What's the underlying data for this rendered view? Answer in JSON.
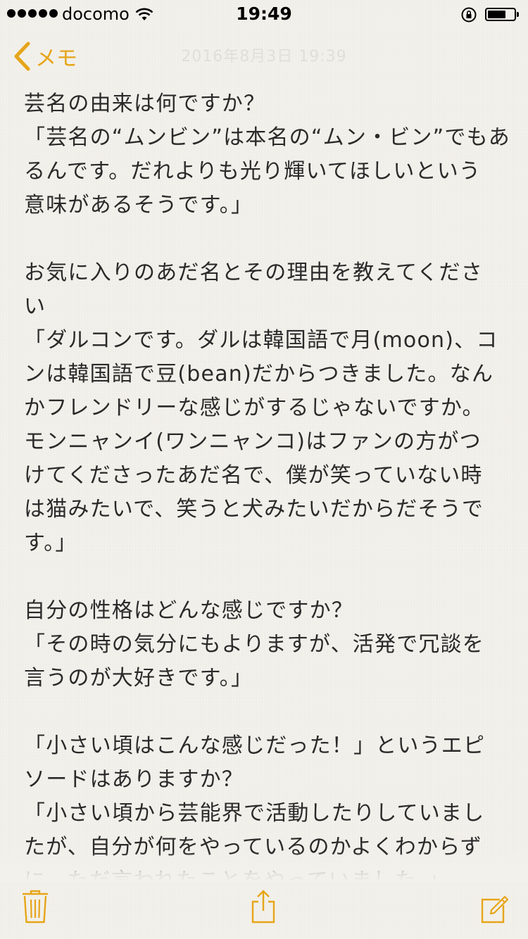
{
  "status_bar": {
    "carrier": "docomo",
    "time": "19:49",
    "battery_level": 0.7
  },
  "nav": {
    "back_label": "メモ",
    "date_text": "2016年8月3日 19:39"
  },
  "note": {
    "paragraphs": [
      {
        "lines": [
          "芸名の由来は何ですか？",
          "「芸名の“ムンビン”は本名の“ムン・ビン”でもあ",
          "るんです。だれよりも光り輝いてほしいという",
          "意味があるそうです。」"
        ]
      },
      {
        "lines": [
          "お気に入りのあだ名とその理由を教えてくださ",
          "い",
          "「ダルコンです。ダルは韓国語で月(moon)、コ",
          "ンは韓国語で豆(bean)だからつきました。なん",
          "かフレンドリーな感じがするじゃないですか。",
          "モンニャンイ(ワンニャンコ)はファンの方がつ",
          "けてくださったあだ名で、僕が笑っていない時",
          "は猫みたいで、笑うと犬みたいだからだそうで",
          "す。」"
        ]
      },
      {
        "lines": [
          "自分の性格はどんな感じですか？",
          "「その時の気分にもよりますが、活発で冗談を",
          "言うのが大好きです。」"
        ]
      },
      {
        "lines": [
          "「小さい頃はこんな感じだった！」というエピ",
          "ソードはありますか？",
          "「小さい頃から芸能界で活動したりしていまし",
          "たが、自分が何をやっているのかよくわからず",
          "に、ただ言われたことをやっていました。」"
        ]
      }
    ]
  },
  "icons": {
    "back": "chevron-left-icon",
    "trash": "trash-icon",
    "share": "share-icon",
    "compose": "compose-icon"
  },
  "colors": {
    "accent": "#e6a519",
    "paper": "#f3f1eb",
    "text": "#2a2a2a"
  }
}
